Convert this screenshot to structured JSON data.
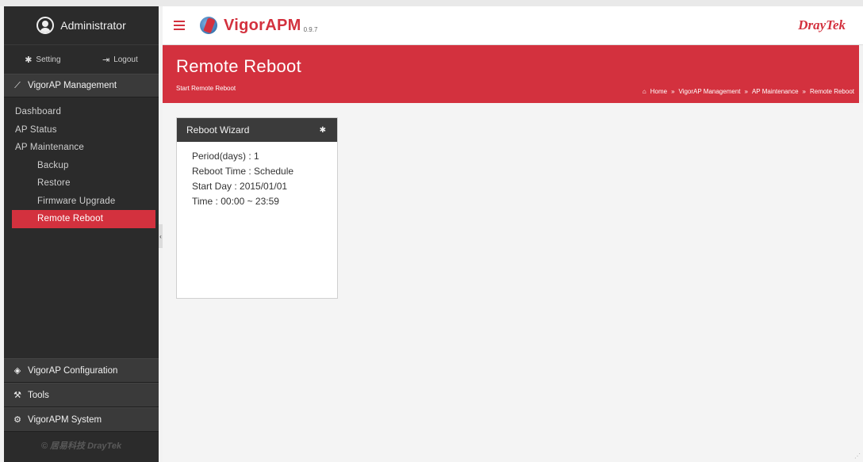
{
  "user": {
    "name": "Administrator",
    "setting_label": "Setting",
    "logout_label": "Logout"
  },
  "sidebar": {
    "management_section": "VigorAP Management",
    "items": [
      {
        "label": "Dashboard"
      },
      {
        "label": "AP Status"
      },
      {
        "label": "AP Maintenance"
      },
      {
        "label": "Backup"
      },
      {
        "label": "Restore"
      },
      {
        "label": "Firmware Upgrade"
      },
      {
        "label": "Remote Reboot"
      }
    ],
    "sections": [
      {
        "label": "VigorAP Configuration",
        "icon": "wifi-icon"
      },
      {
        "label": "Tools",
        "icon": "wrench-icon"
      },
      {
        "label": "VigorAPM System",
        "icon": "gears-icon"
      }
    ],
    "copyright": "© 居易科技 DrayTek"
  },
  "topbar": {
    "brand": "VigorAPM",
    "version": "0.9.7",
    "company_logo": "DrayTek"
  },
  "header": {
    "title": "Remote Reboot",
    "subtitle": "Start Remote Reboot",
    "breadcrumb": [
      "Home",
      "VigorAP Management",
      "AP Maintenance",
      "Remote Reboot"
    ]
  },
  "card": {
    "title": "Reboot Wizard",
    "lines": [
      "Period(days) : 1",
      "Reboot Time : Schedule",
      "Start Day : 2015/01/01",
      "Time : 00:00 ~ 23:59"
    ]
  },
  "colors": {
    "accent": "#d3313e",
    "sidebar_bg": "#2b2b2b",
    "card_head_bg": "#3b3b3b"
  }
}
